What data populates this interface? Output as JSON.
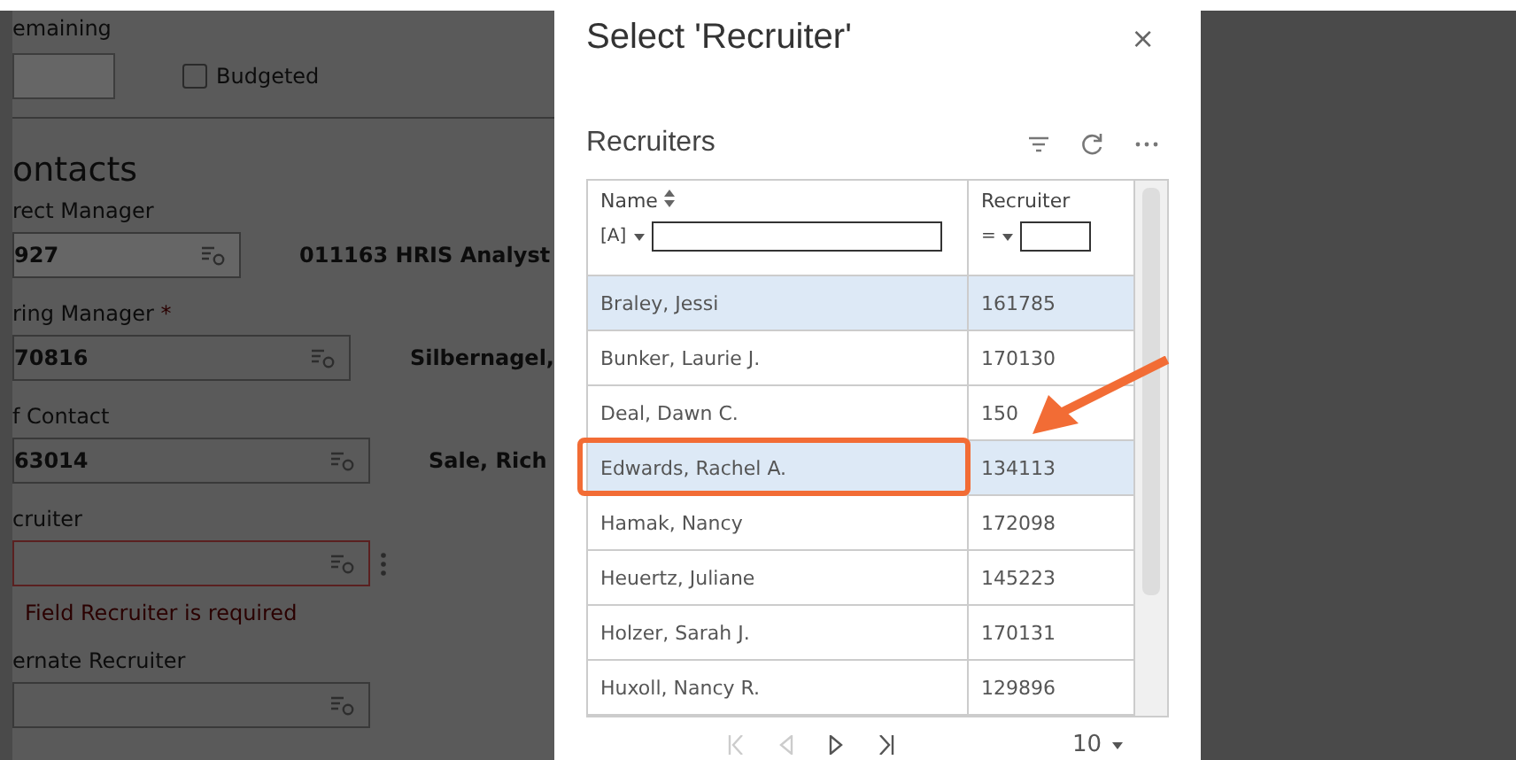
{
  "form": {
    "remaining_label": "emaining",
    "budgeted": {
      "label": "Budgeted",
      "checked": false
    },
    "section_title": "ontacts",
    "fields": [
      {
        "label": "rect Manager",
        "value": "927",
        "disabled": true,
        "lookup_text": "011163 HRIS Analyst"
      },
      {
        "label": "ring Manager",
        "required_mark": "*",
        "value": "70816",
        "disabled": false,
        "lookup_text": "Silbernagel,"
      },
      {
        "label": "f Contact",
        "value": "63014",
        "disabled": false,
        "lookup_text": "Sale, Rich"
      },
      {
        "label": "cruiter",
        "disabled": false,
        "error": "Field Recruiter is required"
      },
      {
        "label": "ernate Recruiter",
        "disabled": false
      }
    ]
  },
  "dialog": {
    "title": "Select 'Recruiter'",
    "close": "×",
    "list_title": "Recruiters",
    "columns": [
      {
        "label": "Name",
        "filter_op": "[A]"
      },
      {
        "label": "Recruiter",
        "filter_op": "="
      }
    ],
    "rows": [
      {
        "name": "Braley, Jessi",
        "recruiter": "161785",
        "selected": true
      },
      {
        "name": "Bunker, Laurie J.",
        "recruiter": "170130",
        "selected": false
      },
      {
        "name": "Deal, Dawn C.",
        "recruiter": "150",
        "selected": false
      },
      {
        "name": "Edwards, Rachel A.",
        "recruiter": "134113",
        "selected": true
      },
      {
        "name": "Hamak, Nancy",
        "recruiter": "172098",
        "selected": false
      },
      {
        "name": "Heuertz, Juliane",
        "recruiter": "145223",
        "selected": false
      },
      {
        "name": "Holzer, Sarah J.",
        "recruiter": "170131",
        "selected": false
      },
      {
        "name": "Huxoll, Nancy R.",
        "recruiter": "129896",
        "selected": false
      }
    ],
    "page_size": "10"
  }
}
